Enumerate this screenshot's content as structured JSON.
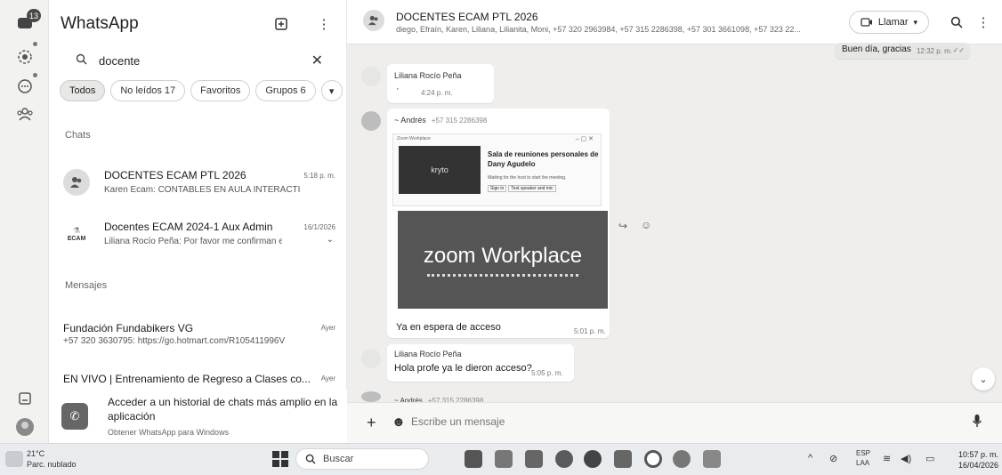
{
  "rail": {
    "badge": "13"
  },
  "sidebar": {
    "app_title": "WhatsApp",
    "search": {
      "value": "docente"
    },
    "filters": [
      {
        "label": "Todos"
      },
      {
        "label": "No leídos 17"
      },
      {
        "label": "Favoritos"
      },
      {
        "label": "Grupos 6"
      }
    ],
    "section_chats": "Chats",
    "chats": [
      {
        "name": "DOCENTES ECAM PTL 2026",
        "time": "5:18 p. m.",
        "preview": "Karen Ecam: CONTABLES EN AULA INTERACTIVA ..."
      },
      {
        "name": "Docentes ECAM 2024-1 Aux Admin ...",
        "time": "16/1/2026",
        "preview": "Liliana Rocío Peña: Por favor me confirman el r...",
        "logo_text": "ECAM"
      }
    ],
    "section_messages": "Mensajes",
    "messages": [
      {
        "name": "Fundación Fundabikers VG",
        "time": "Ayer",
        "preview": "+57 320 3630795: https://go.hotmart.com/R105411996V"
      },
      {
        "name": "EN VIVO | Entrenamiento de Regreso a Clases co...",
        "time": "Ayer"
      }
    ],
    "promo": {
      "title": "Acceder a un historial de chats más amplio en la aplicación",
      "subtitle": "Obtener WhatsApp para Windows"
    }
  },
  "conversation": {
    "title": "DOCENTES ECAM PTL 2026",
    "members": "diego, Efraín, Karen, Liliana, Lilianita, Moni, +57 320 2963984, +57 315 2286398, +57 301 3661098, +57 323 22...",
    "call_label": "Llamar",
    "top_partial": {
      "text": "Buen día, gracias",
      "time": "12:32 p. m."
    },
    "messages": [
      {
        "sender": "Liliana Rocío Peña",
        "text": "·",
        "time": "4:24 p. m."
      },
      {
        "sender": "~ Andrés",
        "phone": "+57 315 2286398",
        "zoom": {
          "window_title": "Zoom Workplace",
          "heading": "Sala de reuniones personales de Dany Agudelo",
          "waiting": "Waiting for the host to start the meeting.",
          "tile_name": "kryto",
          "buttons": [
            "Sign in",
            "Test speaker and mic"
          ],
          "brand": "zoom Workplace"
        },
        "text": "Ya en espera de acceso",
        "time": "5:01 p. m."
      },
      {
        "sender": "Liliana Rocío Peña",
        "text": "Hola profe ya le dieron acceso?",
        "time": "5:05 p. m."
      },
      {
        "sender": "~ Andrés",
        "phone": "+57 315 2286398"
      }
    ],
    "composer_placeholder": "Escribe un mensaje"
  },
  "taskbar": {
    "weather_temp": "21°C",
    "weather_desc": "Parc. nublado",
    "search_label": "Buscar",
    "lang": "ESP",
    "lang2": "LAA",
    "time": "10:57 p. m.",
    "date": "16/04/2026"
  }
}
